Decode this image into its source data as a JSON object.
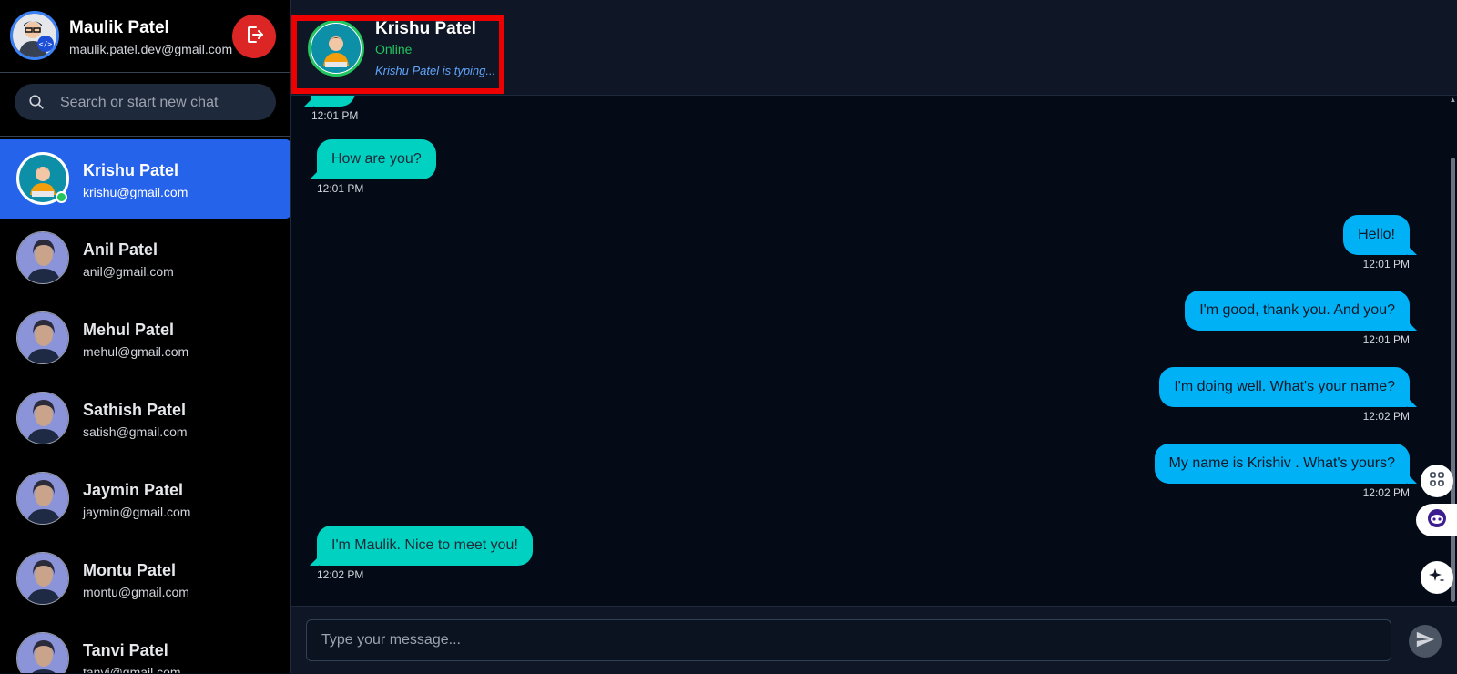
{
  "current_user": {
    "name": "Maulik Patel",
    "email": "maulik.patel.dev@gmail.com"
  },
  "search": {
    "placeholder": "Search or start new chat"
  },
  "contacts": [
    {
      "name": "Krishu Patel",
      "email": "krishu@gmail.com",
      "active": true,
      "online": true
    },
    {
      "name": "Anil Patel",
      "email": "anil@gmail.com"
    },
    {
      "name": "Mehul Patel",
      "email": "mehul@gmail.com"
    },
    {
      "name": "Sathish Patel",
      "email": "satish@gmail.com"
    },
    {
      "name": "Jaymin Patel",
      "email": "jaymin@gmail.com"
    },
    {
      "name": "Montu Patel",
      "email": "montu@gmail.com"
    },
    {
      "name": "Tanvi Patel",
      "email": "tanvi@gmail.com"
    }
  ],
  "chat_header": {
    "name": "Krishu Patel",
    "status": "Online",
    "typing": "Krishu Patel is typing..."
  },
  "messages": [
    {
      "direction": "in",
      "text": "",
      "time": "12:01 PM"
    },
    {
      "direction": "in",
      "text": "How are you?",
      "time": "12:01 PM"
    },
    {
      "direction": "out",
      "text": "Hello!",
      "time": "12:01 PM"
    },
    {
      "direction": "out",
      "text": "I'm good, thank you. And you?",
      "time": "12:01 PM"
    },
    {
      "direction": "out",
      "text": "I'm doing well. What's your name?",
      "time": "12:02 PM"
    },
    {
      "direction": "out",
      "text": "My name is Krishiv . What's yours?",
      "time": "12:02 PM"
    },
    {
      "direction": "in",
      "text": "I'm Maulik. Nice to meet you!",
      "time": "12:02 PM"
    }
  ],
  "composer": {
    "placeholder": "Type your message..."
  },
  "icons": {
    "logout": "logout-icon",
    "search": "search-icon",
    "send": "send-icon",
    "apps": "apps-grid-icon",
    "assistant": "assistant-bot-icon",
    "sparkle": "sparkle-icon"
  },
  "colors": {
    "active_contact": "#2563eb",
    "incoming_bubble": "#00d1c1",
    "outgoing_bubble": "#00b2f5",
    "online": "#22c55e",
    "logout": "#dc2626",
    "highlight_box": "#ef0000"
  }
}
